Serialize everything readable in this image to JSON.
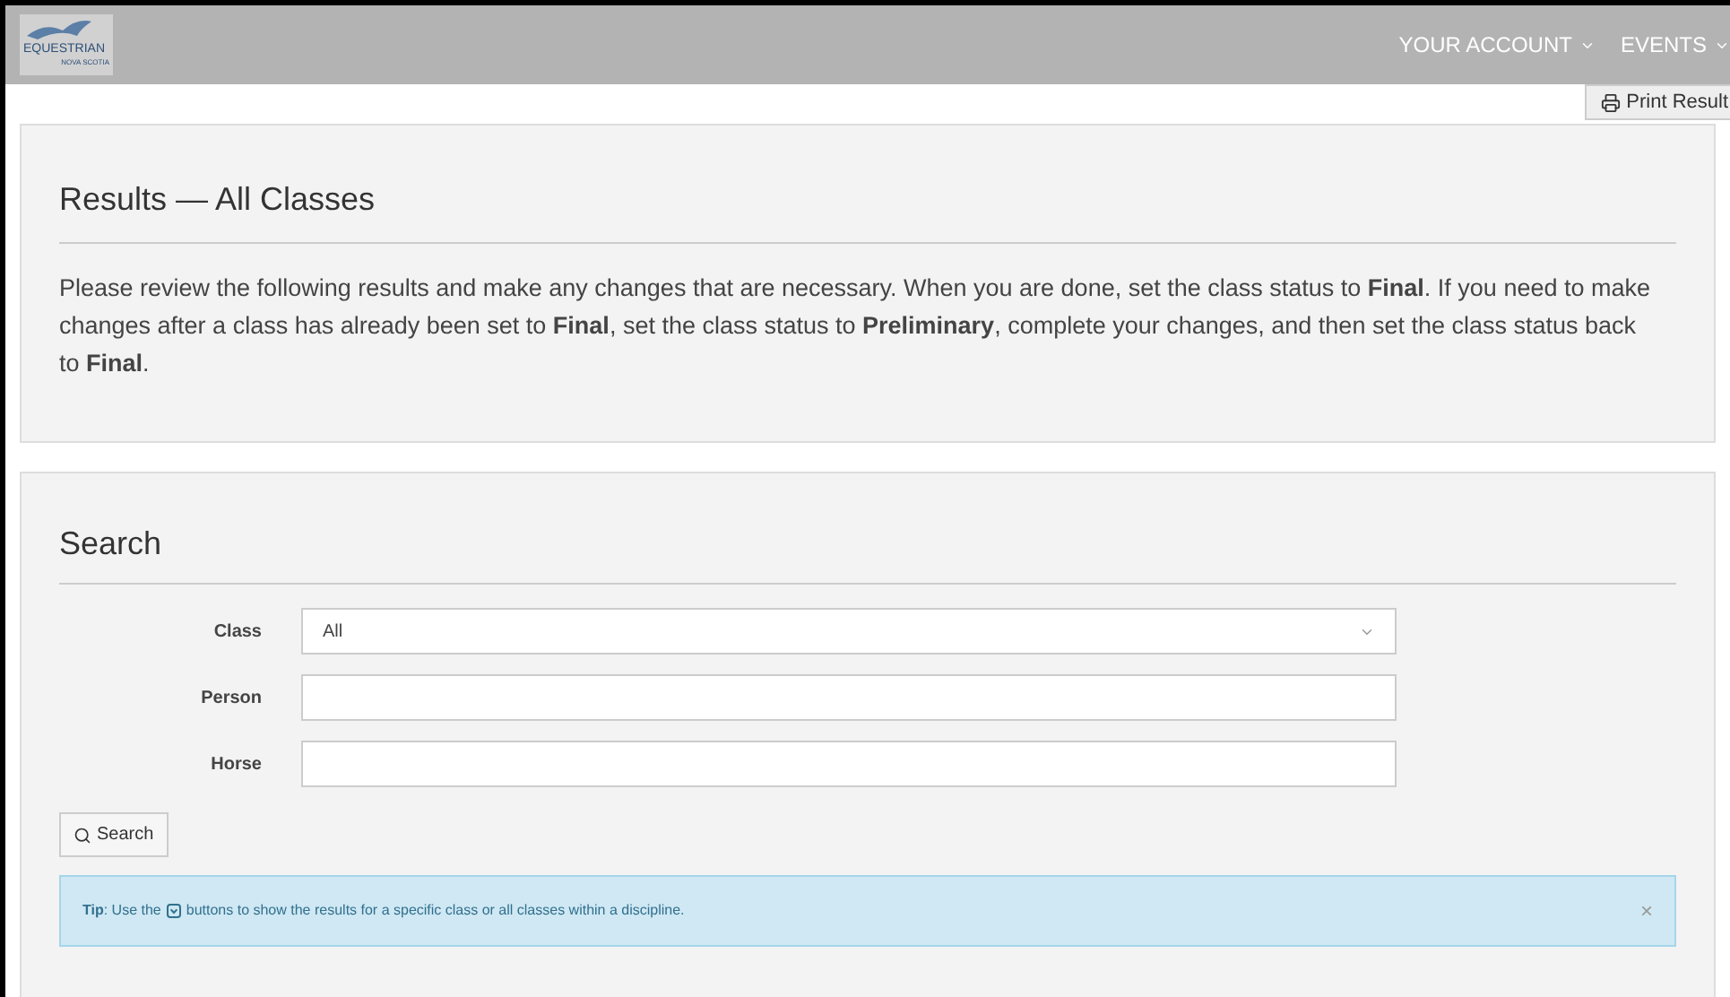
{
  "header": {
    "logo_text": "EQUESTRIAN",
    "logo_subtext": "NOVA SCOTIA",
    "nav": [
      "YOUR ACCOUNT",
      "EVENTS"
    ]
  },
  "print_button": "Print Result",
  "results_panel": {
    "title": "Results — All Classes",
    "text": "Please review the following results and make any changes that are necessary. When you are done, set the class status to **Final**. If you need to make changes after a class has already been set to **Final**, set the class status to **Preliminary**, complete your changes, and then set the class status back to **Final**."
  },
  "search_panel": {
    "title": "Search",
    "fields": [
      {
        "label": "Class",
        "kind": "select",
        "value": "All"
      },
      {
        "label": "Person",
        "kind": "text"
      },
      {
        "label": "Horse",
        "kind": "text"
      }
    ],
    "button": "Search"
  },
  "tip": {
    "lead": "**Tip**: Use the",
    "rest": "buttons to show the results for a specific class or all classes within a discipline.",
    "close": "×"
  }
}
